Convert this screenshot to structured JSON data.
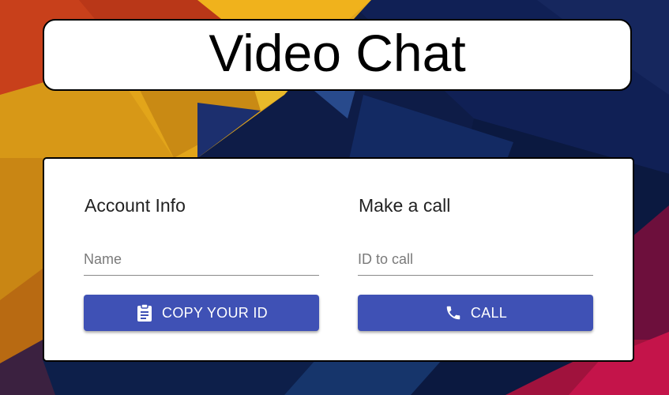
{
  "app": {
    "title": "Video Chat"
  },
  "account": {
    "heading": "Account Info",
    "name_placeholder": "Name",
    "name_value": "",
    "copy_button_label": "COPY YOUR ID",
    "copy_icon": "clipboard-icon"
  },
  "call": {
    "heading": "Make a call",
    "id_placeholder": "ID to call",
    "id_value": "",
    "call_button_label": "CALL",
    "call_icon": "phone-icon"
  },
  "colors": {
    "button": "#3f51b5",
    "card": "#ffffff",
    "border": "#000000"
  }
}
